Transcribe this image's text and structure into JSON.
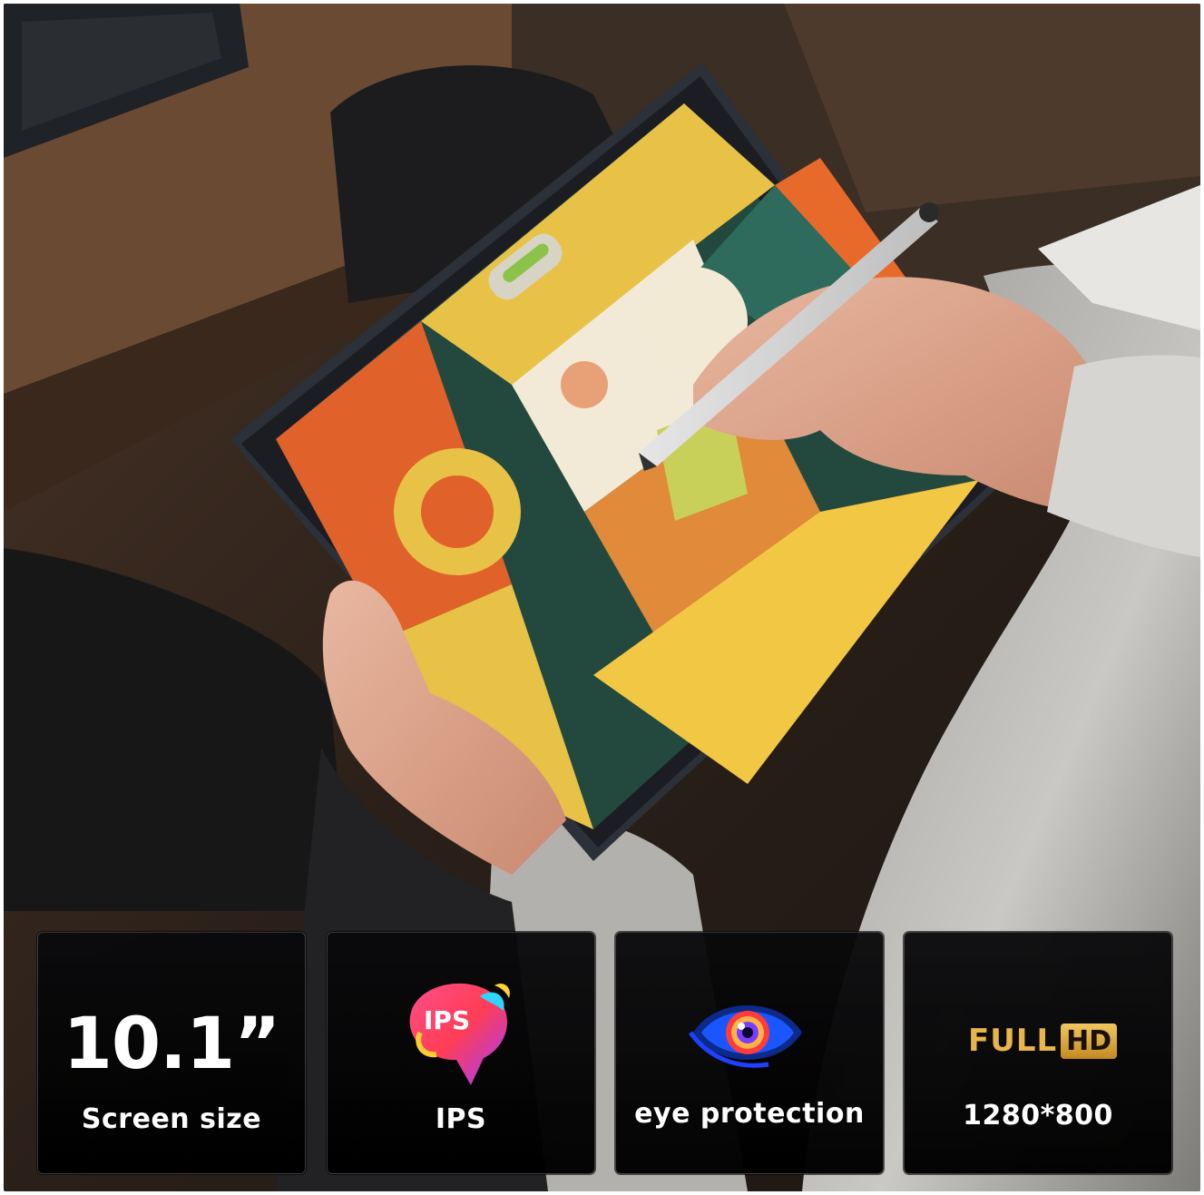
{
  "features": [
    {
      "headline": "10.1”",
      "caption": "Screen size"
    },
    {
      "icon_text": "IPS",
      "caption": "IPS"
    },
    {
      "caption": "eye protection"
    },
    {
      "badge_full": "FULL",
      "badge_hd": "HD",
      "caption": "1280*800"
    }
  ],
  "icons": {
    "ips": "ips-badge-icon",
    "eye": "eye-icon",
    "fullhd": "full-hd-badge-icon"
  },
  "colors": {
    "card_bg": "#050507",
    "badge_gold": "#e8b54a"
  }
}
